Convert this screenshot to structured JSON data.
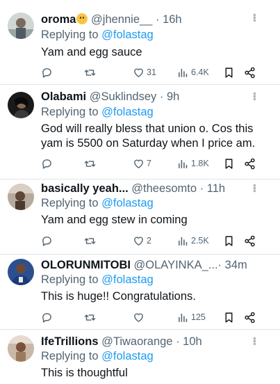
{
  "replying_label": "Replying to",
  "tweets": [
    {
      "name": "oroma",
      "handle": "@jhennie__",
      "time": "16h",
      "reply_to": "@folastag",
      "text": "Yam and egg sauce",
      "likes": "31",
      "views": "6.4K",
      "has_emoji": true,
      "avatar_icon": "user-avatar-photo"
    },
    {
      "name": "Olabami",
      "handle": "@Suklindsey",
      "time": "9h",
      "reply_to": "@folastag",
      "text": "God will really bless that union o. Cos this yam is 5500 on Saturday when I price am.",
      "likes": "7",
      "views": "1.8K",
      "avatar_icon": "user-avatar-photo"
    },
    {
      "name": "basically yeah...",
      "handle": "@theesomto",
      "time": "11h",
      "reply_to": "@folastag",
      "text": "Yam and egg stew in coming",
      "likes": "2",
      "views": "2.5K",
      "avatar_icon": "user-avatar-photo"
    },
    {
      "name": "OLORUNMITOBI",
      "handle": "@OLAYINKA_...",
      "time": "34m",
      "reply_to": "@folastag",
      "text": "This is huge!! Congratulations.",
      "likes": "",
      "views": "125",
      "avatar_icon": "user-avatar-photo"
    },
    {
      "name": "IfeTrillions",
      "handle": "@Tiwaorange",
      "time": "10h",
      "reply_to": "@folastag",
      "text": "This is thoughtful",
      "avatar_icon": "user-avatar-photo"
    }
  ],
  "colors": {
    "link": "#1d9bf0",
    "secondary_text": "#536471",
    "primary_text": "#0f1419"
  }
}
